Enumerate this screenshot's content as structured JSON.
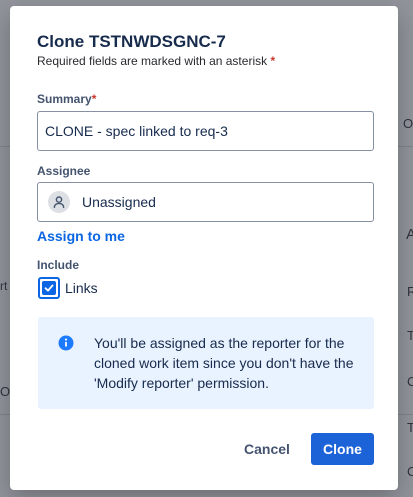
{
  "dialog": {
    "title": "Clone TSTNWDSGNC-7",
    "subtitle": "Required fields are marked with an asterisk",
    "required_mark": "*"
  },
  "summary": {
    "label": "Summary",
    "required_mark": "*",
    "value": "CLONE - spec linked to req-3"
  },
  "assignee": {
    "label": "Assignee",
    "value": "Unassigned",
    "assign_link": "Assign to me"
  },
  "include": {
    "label": "Include",
    "option_label": "Links",
    "checked": true
  },
  "info": {
    "message": "You'll be assigned as the reporter for the cloned work item since you don't have the 'Modify reporter' permission."
  },
  "actions": {
    "cancel_label": "Cancel",
    "clone_label": "Clone"
  },
  "background": {
    "fragments": [
      "Or",
      "A",
      "R",
      "T",
      "C",
      "T",
      "C",
      "rt",
      "O"
    ]
  },
  "colors": {
    "primary": "#1d63d8",
    "link": "#0c66e4",
    "required": "#c9372c",
    "info_bg": "#e9f2ff",
    "info_icon": "#1d7afc"
  }
}
